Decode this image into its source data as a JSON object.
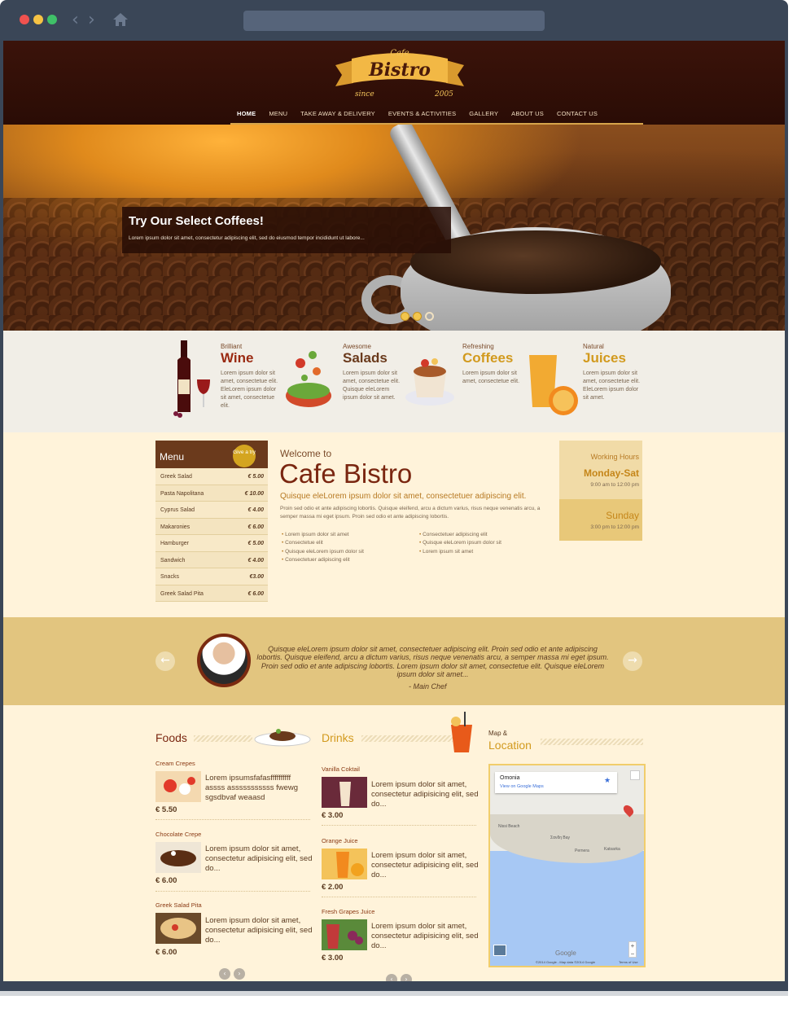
{
  "site": {
    "logo": {
      "top": "Cafe",
      "main": "Bistro",
      "since": "since",
      "year": "2005"
    },
    "nav": [
      "HOME",
      "MENU",
      "TAKE AWAY & DELIVERY",
      "EVENTS & ACTIVITIES",
      "GALLERY",
      "ABOUT US",
      "CONTACT US"
    ]
  },
  "hero": {
    "title": "Try Our Select Coffees!",
    "text": "Lorem ipsum dolor sit amet, consectetur adipiscing elit, sed do eiusmod tempor incididunt ut labore..."
  },
  "features": [
    {
      "small": "Brilliant",
      "big": "Wine",
      "color": "#9a2a12",
      "text": "Lorem ipsum dolor sit amet, consectetue elit. EleLorem ipsum dolor sit amet, consectetue elit."
    },
    {
      "small": "Awesome",
      "big": "Salads",
      "color": "#6a3a1c",
      "text": "Lorem ipsum dolor sit amet, consectetue elit. Quisque eleLorem ipsum dolor sit amet."
    },
    {
      "small": "Refreshing",
      "big": "Coffees",
      "color": "#d29a1e",
      "text": "Lorem ipsum dolor sit amet, consectetue elit."
    },
    {
      "small": "Natural",
      "big": "Juices",
      "color": "#d29a1e",
      "text": "Lorem ipsum dolor sit amet, consectetue elit. EleLorem ipsum dolor sit amet."
    }
  ],
  "menu": {
    "title": "Menu",
    "badge": "Give a try",
    "items": [
      {
        "name": "Greek Salad",
        "price": "€ 5.00"
      },
      {
        "name": "Pasta Napolitana",
        "price": "€ 10.00"
      },
      {
        "name": "Cyprus Salad",
        "price": "€ 4.00"
      },
      {
        "name": "Makaronies",
        "price": "€ 6.00"
      },
      {
        "name": "Hamburger",
        "price": "€ 5.00"
      },
      {
        "name": "Sandwich",
        "price": "€ 4.00"
      },
      {
        "name": "Snacks",
        "price": "€3.00"
      },
      {
        "name": "Greek Salad Pita",
        "price": "€ 6.00"
      }
    ]
  },
  "welcome": {
    "pre": "Welcome to",
    "title": "Cafe Bistro",
    "subtitle": "Quisque eleLorem ipsum dolor sit amet, consectetuer adipiscing elit.",
    "body": "Proin sed odio et ante adipiscing lobortis. Quisque eleifend, arcu a dictum varius, risus neque venenatis arcu, a semper massa mi eget ipsum. Proin sed odio et ante adipiscing lobortis.",
    "bullets_left": [
      "Lorem ipsum dolor sit amet",
      "Consectetue elit",
      "Quisque eleLorem ipsum dolor sit",
      "Consectetuer adipiscing elit"
    ],
    "bullets_right": [
      "Consectetuer adipiscing elit",
      "Quisque eleLorem ipsum dolor sit",
      "Lorem ipsum sit amet"
    ]
  },
  "hours": {
    "label": "Working Hours",
    "weekdays": "Monday-Sat",
    "weekdays_time": "9:00 am to 12:00 pm",
    "sunday": "Sunday",
    "sunday_time": "3:00 pm to 12:00 pm"
  },
  "testimonial": {
    "quote": "Quisque eleLorem ipsum dolor sit amet, consectetuer adipiscing elit. Proin sed odio et ante adipiscing lobortis. Quisque eleifend, arcu a dictum varius, risus neque venenatis arcu, a semper massa mi eget ipsum. Proin sed odio et ante adipiscing lobortis. Lorem ipsum dolor sit amet, consectetue elit. Quisque eleLorem ipsum dolor sit amet...",
    "author": "- Main Chef"
  },
  "foods": {
    "heading": "Foods",
    "items": [
      {
        "title": "Cream Crepes",
        "desc": "Lorem ipsumsfafasffffffffff assss asssssssssss fwewg sgsdbvaf weaasd",
        "price": "€ 5.50"
      },
      {
        "title": "Chocolate Crepe",
        "desc": "Lorem ipsum dolor sit amet, consectetur adipisicing elit, sed do...",
        "price": "€ 6.00"
      },
      {
        "title": "Greek Salad Pita",
        "desc": "Lorem ipsum dolor sit amet, consectetur adipisicing elit, sed do...",
        "price": "€ 6.00"
      }
    ]
  },
  "drinks": {
    "heading": "Drinks",
    "items": [
      {
        "title": "Vanilla Coktail",
        "desc": "Lorem ipsum dolor sit amet, consectetur adipisicing elit, sed do...",
        "price": "€ 3.00"
      },
      {
        "title": "Orange Juice",
        "desc": "Lorem ipsum dolor sit amet, consectetur adipisicing elit, sed do...",
        "price": "€ 2.00"
      },
      {
        "title": "Fresh Grapes Juice",
        "desc": "Lorem ipsum dolor sit amet, consectetur adipisicing elit, sed do...",
        "price": "€ 3.00"
      }
    ]
  },
  "location": {
    "small": "Map &",
    "big": "Location",
    "place": "Omonia",
    "link": "View on Google Maps",
    "labels": [
      "Σανδη Bay",
      "Νissi Beach",
      "Pernera",
      "Katsarka"
    ],
    "google": "Google",
    "attribution": "©2014 Google - Map data ©2014 Google",
    "terms": "Terms of Use"
  },
  "colors": {
    "brown": "#3b130a",
    "gold": "#e2c57f",
    "cream": "#fff3da",
    "accent": "#d29a1e"
  }
}
